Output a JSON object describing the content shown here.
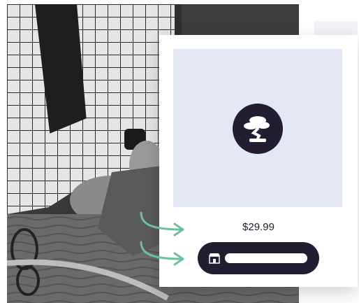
{
  "card": {
    "price": "$29.99",
    "logo_icon": "bonsai-tree-icon",
    "store_icon": "storefront-icon"
  },
  "colors": {
    "card_bg": "#ffffff",
    "image_bg": "#e4e8f3",
    "dark": "#231d31",
    "arrow": "#6fbf9a"
  }
}
